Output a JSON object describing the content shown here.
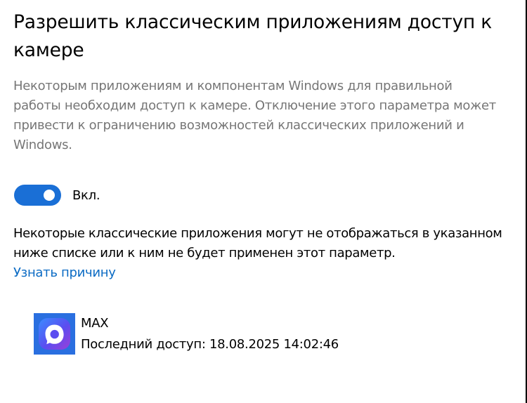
{
  "header": {
    "title": "Разрешить классическим приложениям доступ к камере"
  },
  "description": {
    "text": "Некоторым приложениям и компонентам Windows для правильной работы необходим доступ к камере. Отключение этого параметра может привести к ограничению возможностей классических приложений и Windows."
  },
  "toggle": {
    "state": "on",
    "label": "Вкл.",
    "color": "#1a6fd6"
  },
  "note": {
    "text": "Некоторые классические приложения могут не отображаться в указанном ниже списке или к ним не будет применен этот параметр."
  },
  "link": {
    "label": "Узнать причину",
    "color": "#0b6bc4"
  },
  "apps": [
    {
      "name": "MAX",
      "last_access": "Последний доступ: 18.08.2025 14:02:46",
      "icon": "max-messenger-icon"
    }
  ]
}
